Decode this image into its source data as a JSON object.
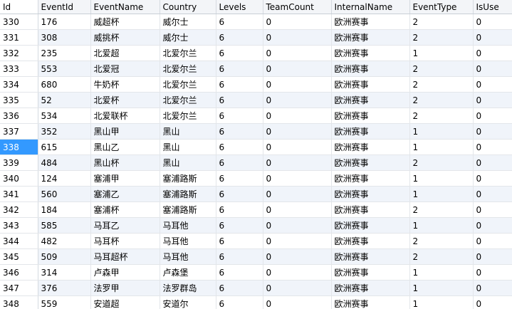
{
  "colors": {
    "selected_row_header": "#3399ff",
    "alt_row": "#f0f4fa",
    "header_bg": "#f3f5f8"
  },
  "table": {
    "columns": [
      "Id",
      "EventId",
      "EventName",
      "Country",
      "Levels",
      "TeamCount",
      "InternalName",
      "EventType",
      "IsUse"
    ],
    "selected_id": "338",
    "rows": [
      [
        "330",
        "176",
        "威超杯",
        "威尔士",
        "6",
        "0",
        "欧洲赛事",
        "2",
        "0"
      ],
      [
        "331",
        "308",
        "威挑杯",
        "威尔士",
        "6",
        "0",
        "欧洲赛事",
        "2",
        "0"
      ],
      [
        "332",
        "235",
        "北爱超",
        "北爱尔兰",
        "6",
        "0",
        "欧洲赛事",
        "1",
        "0"
      ],
      [
        "333",
        "553",
        "北爱冠",
        "北爱尔兰",
        "6",
        "0",
        "欧洲赛事",
        "2",
        "0"
      ],
      [
        "334",
        "680",
        "牛奶杯",
        "北爱尔兰",
        "6",
        "0",
        "欧洲赛事",
        "2",
        "0"
      ],
      [
        "335",
        "52",
        "北爱杯",
        "北爱尔兰",
        "6",
        "0",
        "欧洲赛事",
        "2",
        "0"
      ],
      [
        "336",
        "534",
        "北爱联杯",
        "北爱尔兰",
        "6",
        "0",
        "欧洲赛事",
        "2",
        "0"
      ],
      [
        "337",
        "352",
        "黑山甲",
        "黑山",
        "6",
        "0",
        "欧洲赛事",
        "1",
        "0"
      ],
      [
        "338",
        "615",
        "黑山乙",
        "黑山",
        "6",
        "0",
        "欧洲赛事",
        "1",
        "0"
      ],
      [
        "339",
        "484",
        "黑山杯",
        "黑山",
        "6",
        "0",
        "欧洲赛事",
        "2",
        "0"
      ],
      [
        "340",
        "124",
        "塞浦甲",
        "塞浦路斯",
        "6",
        "0",
        "欧洲赛事",
        "1",
        "0"
      ],
      [
        "341",
        "560",
        "塞浦乙",
        "塞浦路斯",
        "6",
        "0",
        "欧洲赛事",
        "1",
        "0"
      ],
      [
        "342",
        "184",
        "塞浦杯",
        "塞浦路斯",
        "6",
        "0",
        "欧洲赛事",
        "2",
        "0"
      ],
      [
        "343",
        "585",
        "马耳乙",
        "马耳他",
        "6",
        "0",
        "欧洲赛事",
        "1",
        "0"
      ],
      [
        "344",
        "482",
        "马耳杯",
        "马耳他",
        "6",
        "0",
        "欧洲赛事",
        "2",
        "0"
      ],
      [
        "345",
        "509",
        "马耳超杯",
        "马耳他",
        "6",
        "0",
        "欧洲赛事",
        "2",
        "0"
      ],
      [
        "346",
        "314",
        "卢森甲",
        "卢森堡",
        "6",
        "0",
        "欧洲赛事",
        "1",
        "0"
      ],
      [
        "347",
        "376",
        "法罗甲",
        "法罗群岛",
        "6",
        "0",
        "欧洲赛事",
        "1",
        "0"
      ],
      [
        "348",
        "559",
        "安道超",
        "安道尔",
        "6",
        "0",
        "欧洲赛事",
        "1",
        "0"
      ]
    ]
  }
}
